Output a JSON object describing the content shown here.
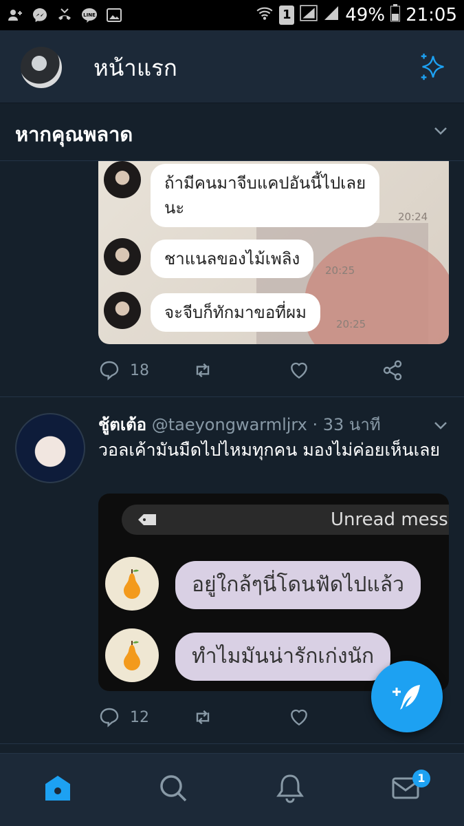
{
  "status_bar": {
    "battery": "49%",
    "time": "21:05",
    "sim_slot": "1",
    "left_icons": [
      "add-contact-icon",
      "messenger-icon",
      "missed-call-icon",
      "line-icon",
      "gallery-icon"
    ]
  },
  "header": {
    "title": "หน้าแรก",
    "sparkle_icon": "sparkle-icon"
  },
  "missed_section": {
    "label": "หากคุณพลาด"
  },
  "tweet1": {
    "image_messages": [
      {
        "text_line1": "ถ้ามีคนมาจีบแคปอันนี้ไปเลย",
        "text_line2": "นะ",
        "time": "20:24"
      },
      {
        "text": "ชาแนลของไม้เพลิง",
        "time": "20:25"
      },
      {
        "text": "จะจีบก็ทักมาขอที่ผม",
        "time": "20:25"
      }
    ],
    "reply_count": "18"
  },
  "tweet2": {
    "name": "ชู้ตเต้อ",
    "handle": "@taeyongwarmljrx",
    "time": "33 นาที",
    "text": "วอลเค้ามันมืดไปไหมทุกคน มองไม่ค่อยเห็นเลย",
    "image_unread": "Unread mess",
    "image_messages": [
      "อยู่ใกล้ๆนี่โดนฟัดไปแล้ว",
      "ทำไมมันน่ารักเก่งนัก"
    ],
    "reply_count": "12"
  },
  "bottom_nav": {
    "items": [
      "home-icon",
      "search-icon",
      "notifications-icon",
      "messages-icon"
    ],
    "messages_badge": "1"
  },
  "colors": {
    "background": "#15202b",
    "bar": "#1c2938",
    "accent": "#1da1f2",
    "muted": "#8899a6"
  }
}
